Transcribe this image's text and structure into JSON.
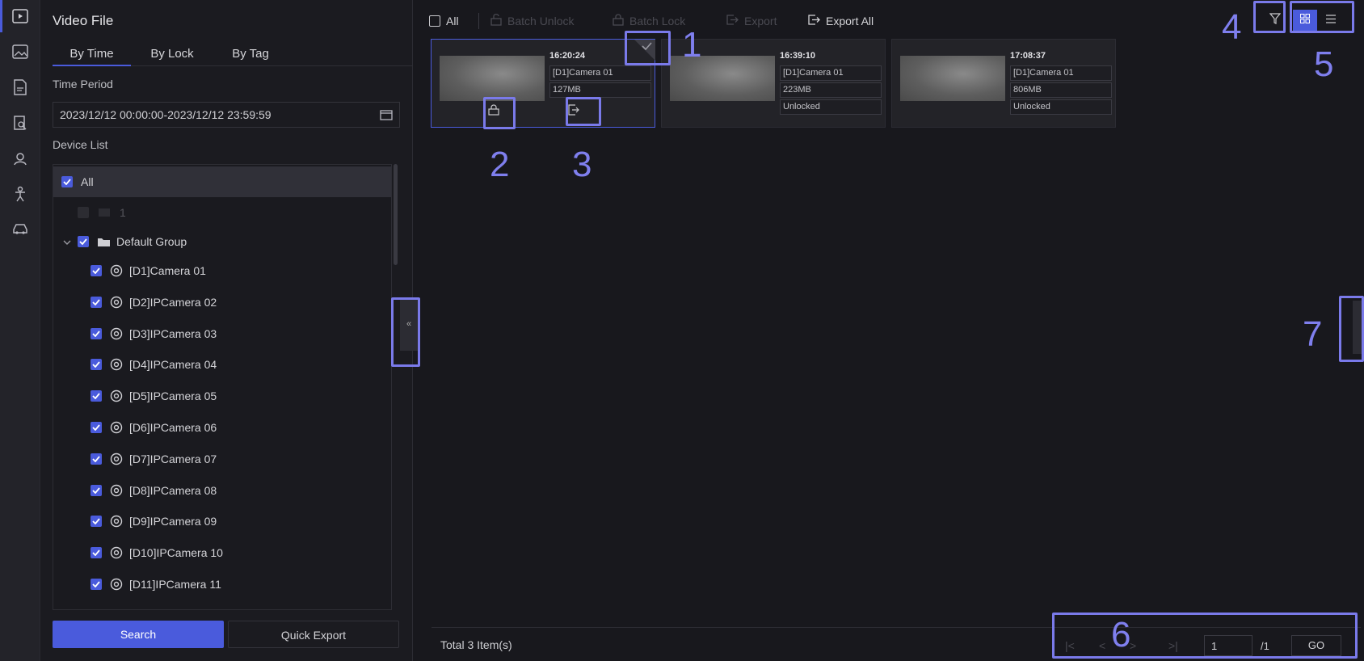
{
  "sidebar_title": "Video File",
  "tabs": [
    {
      "label": "By Time"
    },
    {
      "label": "By Lock"
    },
    {
      "label": "By Tag"
    }
  ],
  "time_period_label": "Time Period",
  "time_period_value": "2023/12/12 00:00:00-2023/12/12 23:59:59",
  "device_list_label": "Device List",
  "tree": {
    "all": "All",
    "disabled_item": "1",
    "group": "Default Group",
    "cameras": [
      "[D1]Camera 01",
      "[D2]IPCamera 02",
      "[D3]IPCamera 03",
      "[D4]IPCamera 04",
      "[D5]IPCamera 05",
      "[D6]IPCamera 06",
      "[D7]IPCamera 07",
      "[D8]IPCamera 08",
      "[D9]IPCamera 09",
      "[D10]IPCamera 10",
      "[D11]IPCamera 11"
    ]
  },
  "search_label": "Search",
  "quick_export_label": "Quick Export",
  "toolbar": {
    "all": "All",
    "batch_unlock": "Batch Unlock",
    "batch_lock": "Batch Lock",
    "export": "Export",
    "export_all": "Export All"
  },
  "cards": [
    {
      "time": "16:20:24",
      "camera": "[D1]Camera 01",
      "size": "127MB",
      "status": ""
    },
    {
      "time": "16:39:10",
      "camera": "[D1]Camera 01",
      "size": "223MB",
      "status": "Unlocked"
    },
    {
      "time": "17:08:37",
      "camera": "[D1]Camera 01",
      "size": "806MB",
      "status": "Unlocked"
    }
  ],
  "footer": {
    "total": "Total 3 Item(s)",
    "page_input": "1",
    "page_total": "/1",
    "go": "GO"
  },
  "annotations": [
    "1",
    "2",
    "3",
    "4",
    "5",
    "6",
    "7"
  ],
  "colors": {
    "accent": "#4a5bdc",
    "annotation": "#7a7aea",
    "background": "#18181d"
  }
}
